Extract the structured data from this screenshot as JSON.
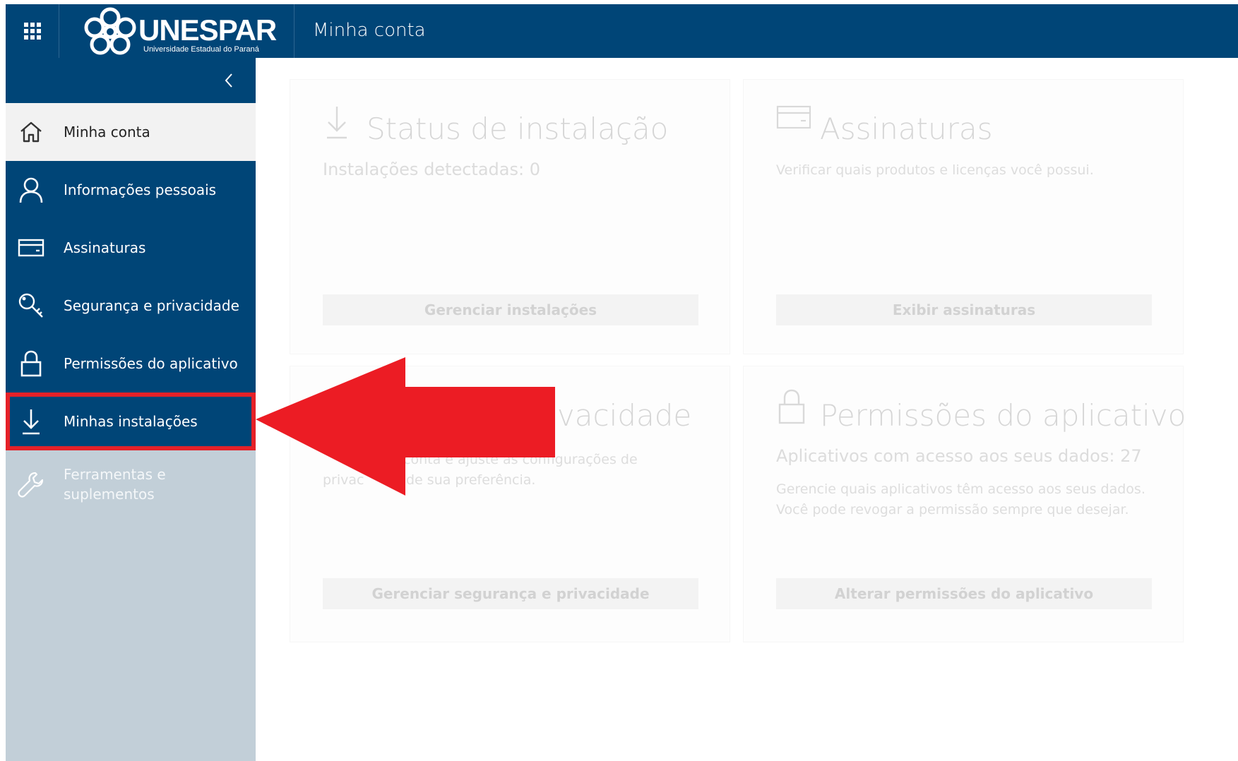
{
  "header": {
    "logo_text": "UNESPAR",
    "logo_subtitle": "Universidade Estadual do Paraná",
    "title": "Minha conta"
  },
  "sidebar": {
    "items": [
      {
        "label": "Minha conta",
        "icon": "home-icon"
      },
      {
        "label": "Informações pessoais",
        "icon": "person-icon"
      },
      {
        "label": "Assinaturas",
        "icon": "card-icon"
      },
      {
        "label": "Segurança e privacidade",
        "icon": "key-icon"
      },
      {
        "label": "Permissões do aplicativo",
        "icon": "lock-icon"
      },
      {
        "label": "Minhas instalações",
        "icon": "download-icon"
      },
      {
        "label": "Ferramentas e suplementos",
        "icon": "wrench-icon"
      }
    ]
  },
  "cards": {
    "install": {
      "title": "Status de instalação",
      "subtitle": "Instalações detectadas: 0",
      "button": "Gerenciar instalações"
    },
    "subscriptions": {
      "title": "Assinaturas",
      "description": "Verificar quais produtos e licenças você possui.",
      "button": "Exibir assinaturas"
    },
    "security": {
      "title_visible": "rivacidade",
      "description_line1": "conta e ajuste as configurações de",
      "description_line2_a": "privac",
      "description_line2_b": "de sua preferência.",
      "button": "Gerenciar segurança e privacidade"
    },
    "permissions": {
      "title": "Permissões do aplicativo",
      "subtitle": "Aplicativos com acesso aos seus dados: 27",
      "description": "Gerencie quais aplicativos têm acesso aos seus dados. Você pode revogar a permissão sempre que desejar.",
      "button": "Alterar permissões do aplicativo"
    }
  },
  "colors": {
    "brand_blue": "#004577",
    "highlight_red": "#e52128",
    "sidebar_disabled": "#c2cfd8"
  }
}
